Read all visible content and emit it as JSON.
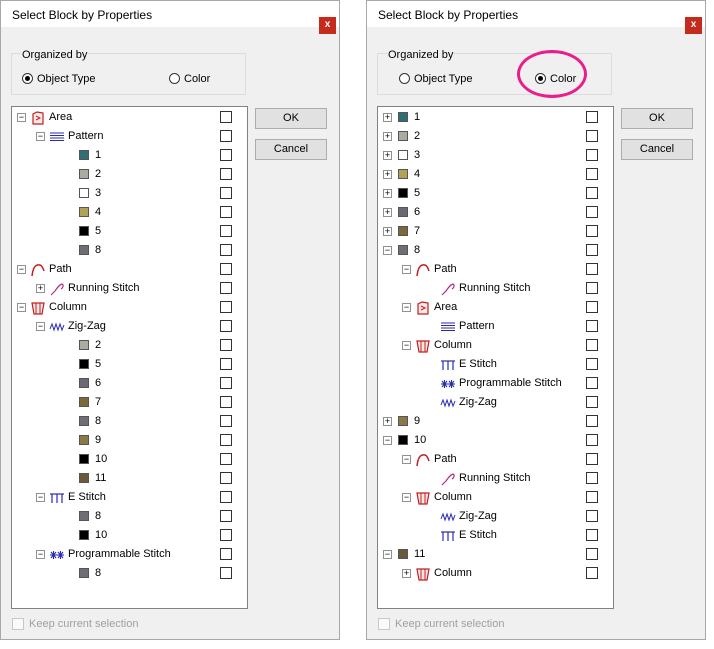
{
  "dialog_title": "Select Block by Properties",
  "close_label": "x",
  "organized_by_label": "Organized by",
  "radio_object_type": "Object Type",
  "radio_color": "Color",
  "ok_label": "OK",
  "cancel_label": "Cancel",
  "keep_selection_label": "Keep current selection",
  "colors": {
    "1": "#2e6e74",
    "2": "#ababa2",
    "3": "#ffffff",
    "4": "#b3a256",
    "5": "#000000",
    "6": "#6a6a72",
    "7": "#7a6a3a",
    "8": "#6e6e74",
    "9": "#8a7a4a",
    "10": "#000000",
    "11": "#6a5a3a",
    "highlight": "#e91e8c",
    "close": "#c42b1c"
  },
  "left_dialog": {
    "selected": "object_type",
    "tree": [
      {
        "indent": 0,
        "exp": "minus",
        "icon": "area-icon",
        "label": "Area"
      },
      {
        "indent": 1,
        "exp": "minus",
        "icon": "pattern-icon",
        "label": "Pattern"
      },
      {
        "indent": 2,
        "exp": "",
        "swatch": "1",
        "label": "1"
      },
      {
        "indent": 2,
        "exp": "",
        "swatch": "2",
        "label": "2"
      },
      {
        "indent": 2,
        "exp": "",
        "swatch": "3",
        "label": "3"
      },
      {
        "indent": 2,
        "exp": "",
        "swatch": "4",
        "label": "4"
      },
      {
        "indent": 2,
        "exp": "",
        "swatch": "5",
        "label": "5"
      },
      {
        "indent": 2,
        "exp": "",
        "swatch": "8",
        "label": "8"
      },
      {
        "indent": 0,
        "exp": "minus",
        "icon": "path-icon",
        "label": "Path"
      },
      {
        "indent": 1,
        "exp": "plus",
        "icon": "running-stitch-icon",
        "label": "Running Stitch"
      },
      {
        "indent": 0,
        "exp": "minus",
        "icon": "column-icon",
        "label": "Column"
      },
      {
        "indent": 1,
        "exp": "minus",
        "icon": "zigzag-icon",
        "label": "Zig-Zag"
      },
      {
        "indent": 2,
        "exp": "",
        "swatch": "2",
        "label": "2"
      },
      {
        "indent": 2,
        "exp": "",
        "swatch": "5",
        "label": "5"
      },
      {
        "indent": 2,
        "exp": "",
        "swatch": "6",
        "label": "6"
      },
      {
        "indent": 2,
        "exp": "",
        "swatch": "7",
        "label": "7"
      },
      {
        "indent": 2,
        "exp": "",
        "swatch": "8",
        "label": "8"
      },
      {
        "indent": 2,
        "exp": "",
        "swatch": "9",
        "label": "9"
      },
      {
        "indent": 2,
        "exp": "",
        "swatch": "10",
        "label": "10"
      },
      {
        "indent": 2,
        "exp": "",
        "swatch": "11",
        "label": "11"
      },
      {
        "indent": 1,
        "exp": "minus",
        "icon": "e-stitch-icon",
        "label": "E Stitch"
      },
      {
        "indent": 2,
        "exp": "",
        "swatch": "8",
        "label": "8"
      },
      {
        "indent": 2,
        "exp": "",
        "swatch": "10",
        "label": "10"
      },
      {
        "indent": 1,
        "exp": "minus",
        "icon": "programmable-stitch-icon",
        "label": "Programmable Stitch"
      },
      {
        "indent": 2,
        "exp": "",
        "swatch": "8",
        "label": "8"
      }
    ]
  },
  "right_dialog": {
    "selected": "color",
    "tree": [
      {
        "indent": 0,
        "exp": "plus",
        "swatch": "1",
        "label": "1"
      },
      {
        "indent": 0,
        "exp": "plus",
        "swatch": "2",
        "label": "2"
      },
      {
        "indent": 0,
        "exp": "plus",
        "swatch": "3",
        "label": "3"
      },
      {
        "indent": 0,
        "exp": "plus",
        "swatch": "4",
        "label": "4"
      },
      {
        "indent": 0,
        "exp": "plus",
        "swatch": "5",
        "label": "5"
      },
      {
        "indent": 0,
        "exp": "plus",
        "swatch": "6",
        "label": "6"
      },
      {
        "indent": 0,
        "exp": "plus",
        "swatch": "7",
        "label": "7"
      },
      {
        "indent": 0,
        "exp": "minus",
        "swatch": "8",
        "label": "8"
      },
      {
        "indent": 1,
        "exp": "minus",
        "icon": "path-icon",
        "label": "Path"
      },
      {
        "indent": 2,
        "exp": "",
        "icon": "running-stitch-icon",
        "label": "Running Stitch"
      },
      {
        "indent": 1,
        "exp": "minus",
        "icon": "area-icon",
        "label": "Area"
      },
      {
        "indent": 2,
        "exp": "",
        "icon": "pattern-icon",
        "label": "Pattern"
      },
      {
        "indent": 1,
        "exp": "minus",
        "icon": "column-icon",
        "label": "Column"
      },
      {
        "indent": 2,
        "exp": "",
        "icon": "e-stitch-icon",
        "label": "E Stitch"
      },
      {
        "indent": 2,
        "exp": "",
        "icon": "programmable-stitch-icon",
        "label": "Programmable Stitch"
      },
      {
        "indent": 2,
        "exp": "",
        "icon": "zigzag-icon",
        "label": "Zig-Zag"
      },
      {
        "indent": 0,
        "exp": "plus",
        "swatch": "9",
        "label": "9"
      },
      {
        "indent": 0,
        "exp": "minus",
        "swatch": "10",
        "label": "10"
      },
      {
        "indent": 1,
        "exp": "minus",
        "icon": "path-icon",
        "label": "Path"
      },
      {
        "indent": 2,
        "exp": "",
        "icon": "running-stitch-icon",
        "label": "Running Stitch"
      },
      {
        "indent": 1,
        "exp": "minus",
        "icon": "column-icon",
        "label": "Column"
      },
      {
        "indent": 2,
        "exp": "",
        "icon": "zigzag-icon",
        "label": "Zig-Zag"
      },
      {
        "indent": 2,
        "exp": "",
        "icon": "e-stitch-icon",
        "label": "E Stitch"
      },
      {
        "indent": 0,
        "exp": "minus",
        "swatch": "11",
        "label": "11"
      },
      {
        "indent": 1,
        "exp": "plus",
        "icon": "column-icon",
        "label": "Column"
      }
    ]
  }
}
